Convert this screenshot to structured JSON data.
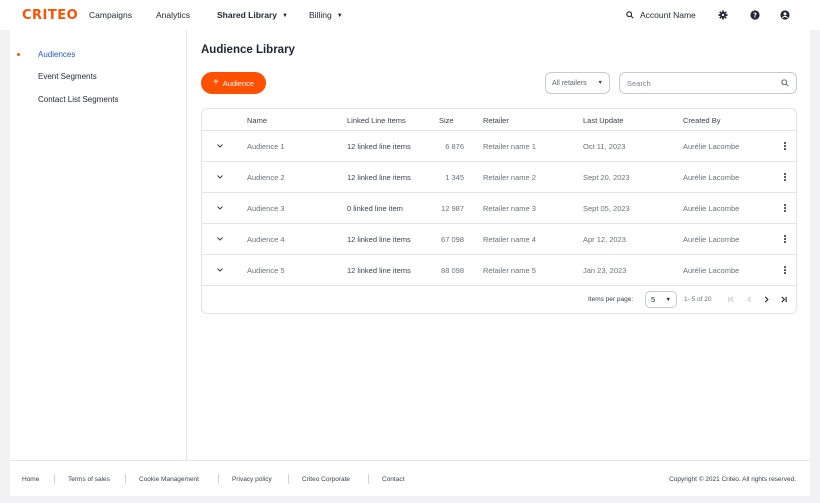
{
  "brand": {
    "logo_text": "CRITEO",
    "accent": "#fe5000",
    "link": "#2357d6"
  },
  "nav": {
    "campaigns": "Campaigns",
    "analytics": "Analytics",
    "shared_library": "Shared Library",
    "billing": "Billing",
    "account": "Account Name"
  },
  "sidebar": {
    "items": [
      {
        "label": "Audiences",
        "active": true
      },
      {
        "label": "Event Segments",
        "active": false
      },
      {
        "label": "Contact List Segments",
        "active": false
      }
    ]
  },
  "main": {
    "title": "Audience Library",
    "add_button": "Audience",
    "retailer_filter": "All retailers",
    "search_placeholder": "Search"
  },
  "table": {
    "columns": {
      "name": "Name",
      "linked": "Linked Line Items",
      "size": "Size",
      "retailer": "Retailer",
      "last_update": "Last Update",
      "created_by": "Created By"
    },
    "rows": [
      {
        "name": "Audience 1",
        "linked": "12 linked line items",
        "size": "6 876",
        "retailer": "Retailer name 1",
        "last_update": "Oct 11, 2023",
        "created_by": "Aurélie Lacombe"
      },
      {
        "name": "Audience 2",
        "linked": "12 linked line items",
        "size": "1 345",
        "retailer": "Retailer name 2",
        "last_update": "Sept 20, 2023",
        "created_by": "Aurélie Lacombe"
      },
      {
        "name": "Audience 3",
        "linked": "0 linked line item",
        "size": "12 987",
        "retailer": "Retailer name 3",
        "last_update": "Sept 05, 2023",
        "created_by": "Aurélie Lacombe"
      },
      {
        "name": "Audience 4",
        "linked": "12 linked line items",
        "size": "67 098",
        "retailer": "Retailer name 4",
        "last_update": "Apr 12, 2023",
        "created_by": "Aurélie Lacombe"
      },
      {
        "name": "Audience 5",
        "linked": "12 linked line items",
        "size": "88 098",
        "retailer": "Retailer name 5",
        "last_update": "Jan 23, 2023",
        "created_by": "Aurélie Lacombe"
      }
    ],
    "pagination": {
      "items_per_page_label": "Items per page:",
      "page_size": "5",
      "range": "1- 5 of 20"
    }
  },
  "footer": {
    "links": [
      "Home",
      "Terms of sales",
      "Cookie Management",
      "Privacy policy",
      "Criteo Corporate",
      "Contact"
    ],
    "copyright": "Copyright © 2021 Criteo. All rights reserved."
  }
}
